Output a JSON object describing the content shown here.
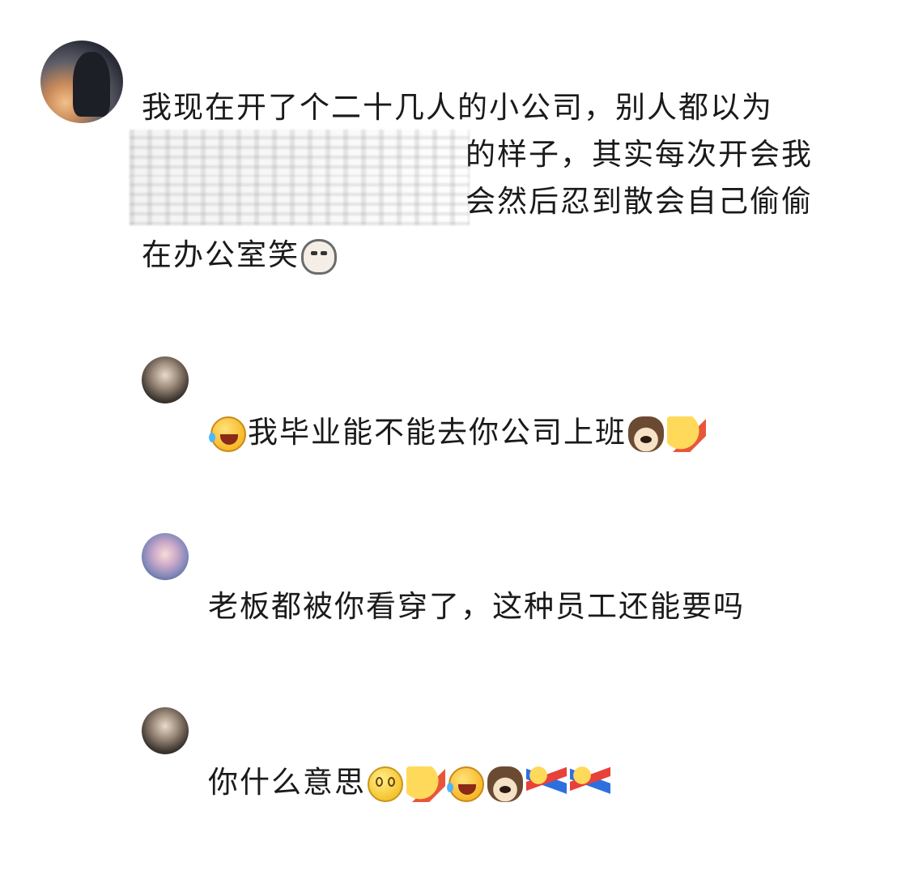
{
  "comments": [
    {
      "lines": [
        "我现在开了个二十几人的小公司，别人都以为",
        "的样子，其实每次开会我",
        "会然后忍到散会自己偷偷",
        "在办公室笑"
      ],
      "emojis": [
        "cat-face-icon"
      ]
    },
    {
      "text": "我毕业能不能去你公司上班",
      "emojis": [
        "rolling-laugh-icon",
        "dog-face-icon",
        "pointing-hand-icon"
      ]
    },
    {
      "text": "老板都被你看穿了，这种员工还能要吗"
    },
    {
      "text": "你什么意思",
      "emojis": [
        "smile-icon",
        "pointing-hand-icon",
        "rolling-laugh-icon",
        "dog-face-icon",
        "kneeling-person-icon",
        "kneeling-person-icon"
      ]
    }
  ]
}
